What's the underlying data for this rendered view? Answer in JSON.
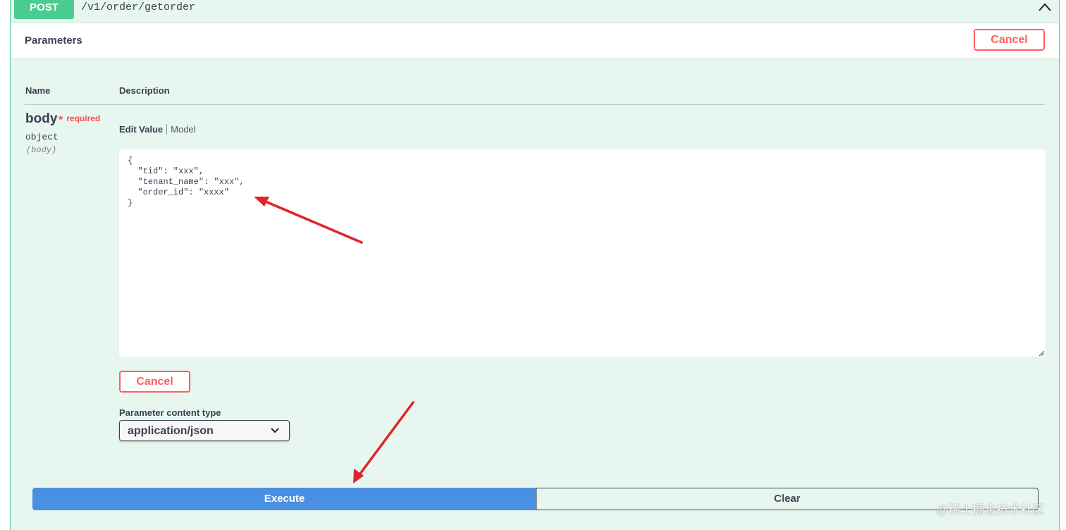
{
  "summary": {
    "method": "POST",
    "path": "/v1/order/getorder"
  },
  "parameters": {
    "title": "Parameters",
    "cancel_label": "Cancel",
    "columns": {
      "name": "Name",
      "description": "Description"
    },
    "param": {
      "name": "body",
      "required_star": "*",
      "required_label": "required",
      "type": "object",
      "in": "(body)"
    },
    "tabs": {
      "edit": "Edit Value",
      "model": "Model"
    },
    "body_value": "{\n  \"tid\": \"xxx\",\n  \"tenant_name\": \"xxx\",\n  \"order_id\": \"xxxx\"\n}",
    "inline_cancel_label": "Cancel",
    "content_type_label": "Parameter content type",
    "content_type_value": "application/json"
  },
  "actions": {
    "execute_label": "Execute",
    "clear_label": "Clear"
  },
  "watermark": "@稀土掘金技术社区",
  "colors": {
    "post_green": "#49cc90",
    "opblock_bg": "#e8f6f0",
    "cancel_red": "#ff6060",
    "execute_blue": "#4990e2",
    "annotation_red": "#e0242c"
  }
}
